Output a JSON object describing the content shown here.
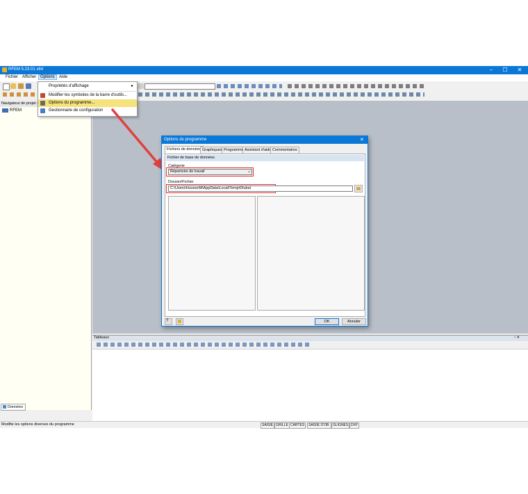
{
  "window": {
    "title": "RFEM 5.23.01 x64",
    "controls": [
      "–",
      "☐",
      "✕"
    ]
  },
  "menubar": {
    "items": [
      "Fichier",
      "Afficher",
      "Options",
      "Aide"
    ]
  },
  "options_menu": {
    "items": [
      {
        "label": "Propriétés d'affichage",
        "has_submenu": true,
        "icon": "display-properties-icon"
      },
      {
        "label": "Modifier les symboles de la barre d'outils...",
        "icon": "toolbar-symbols-icon"
      },
      {
        "label": "Options du programme...",
        "icon": "program-options-icon",
        "highlighted": true
      },
      {
        "label": "Gestionnaire de configuration",
        "icon": "configuration-manager-icon"
      }
    ],
    "submenu_arrow": "▸"
  },
  "navigator": {
    "title": "Navigateur de projet - ...",
    "root_item": "RFEM",
    "bottom_tab": "Données"
  },
  "tables_panel": {
    "title": "Tableaux",
    "controls": "▫ ✕"
  },
  "status_bar": {
    "message": "Modifie les options diverses du programme",
    "cells": [
      "SAISIE",
      "GRILLE",
      "CARTES",
      "SAISIE D'OB.",
      "GLIGNES",
      "DXF"
    ]
  },
  "dialog": {
    "title": "Options du programme",
    "close": "✕",
    "tabs": [
      "Fichiers de données",
      "Graphiques",
      "Programme",
      "Assistant d'aide",
      "Commentaires"
    ],
    "active_tab": 0,
    "group_title": "Fichier de base de données",
    "category_label": "Catégorie",
    "category_value": "Répertoire de travail",
    "folder_label": "Dossier/Fichier",
    "folder_value": "C:\\Users\\HussonM\\AppData\\Local\\Temp\\Dlubal",
    "ok": "OK",
    "cancel": "Annuler"
  },
  "colors": {
    "accent": "#0b78d7",
    "highlight_box": "#e03030",
    "arrow": "#e04040",
    "workspace": "#b9bfc8"
  }
}
